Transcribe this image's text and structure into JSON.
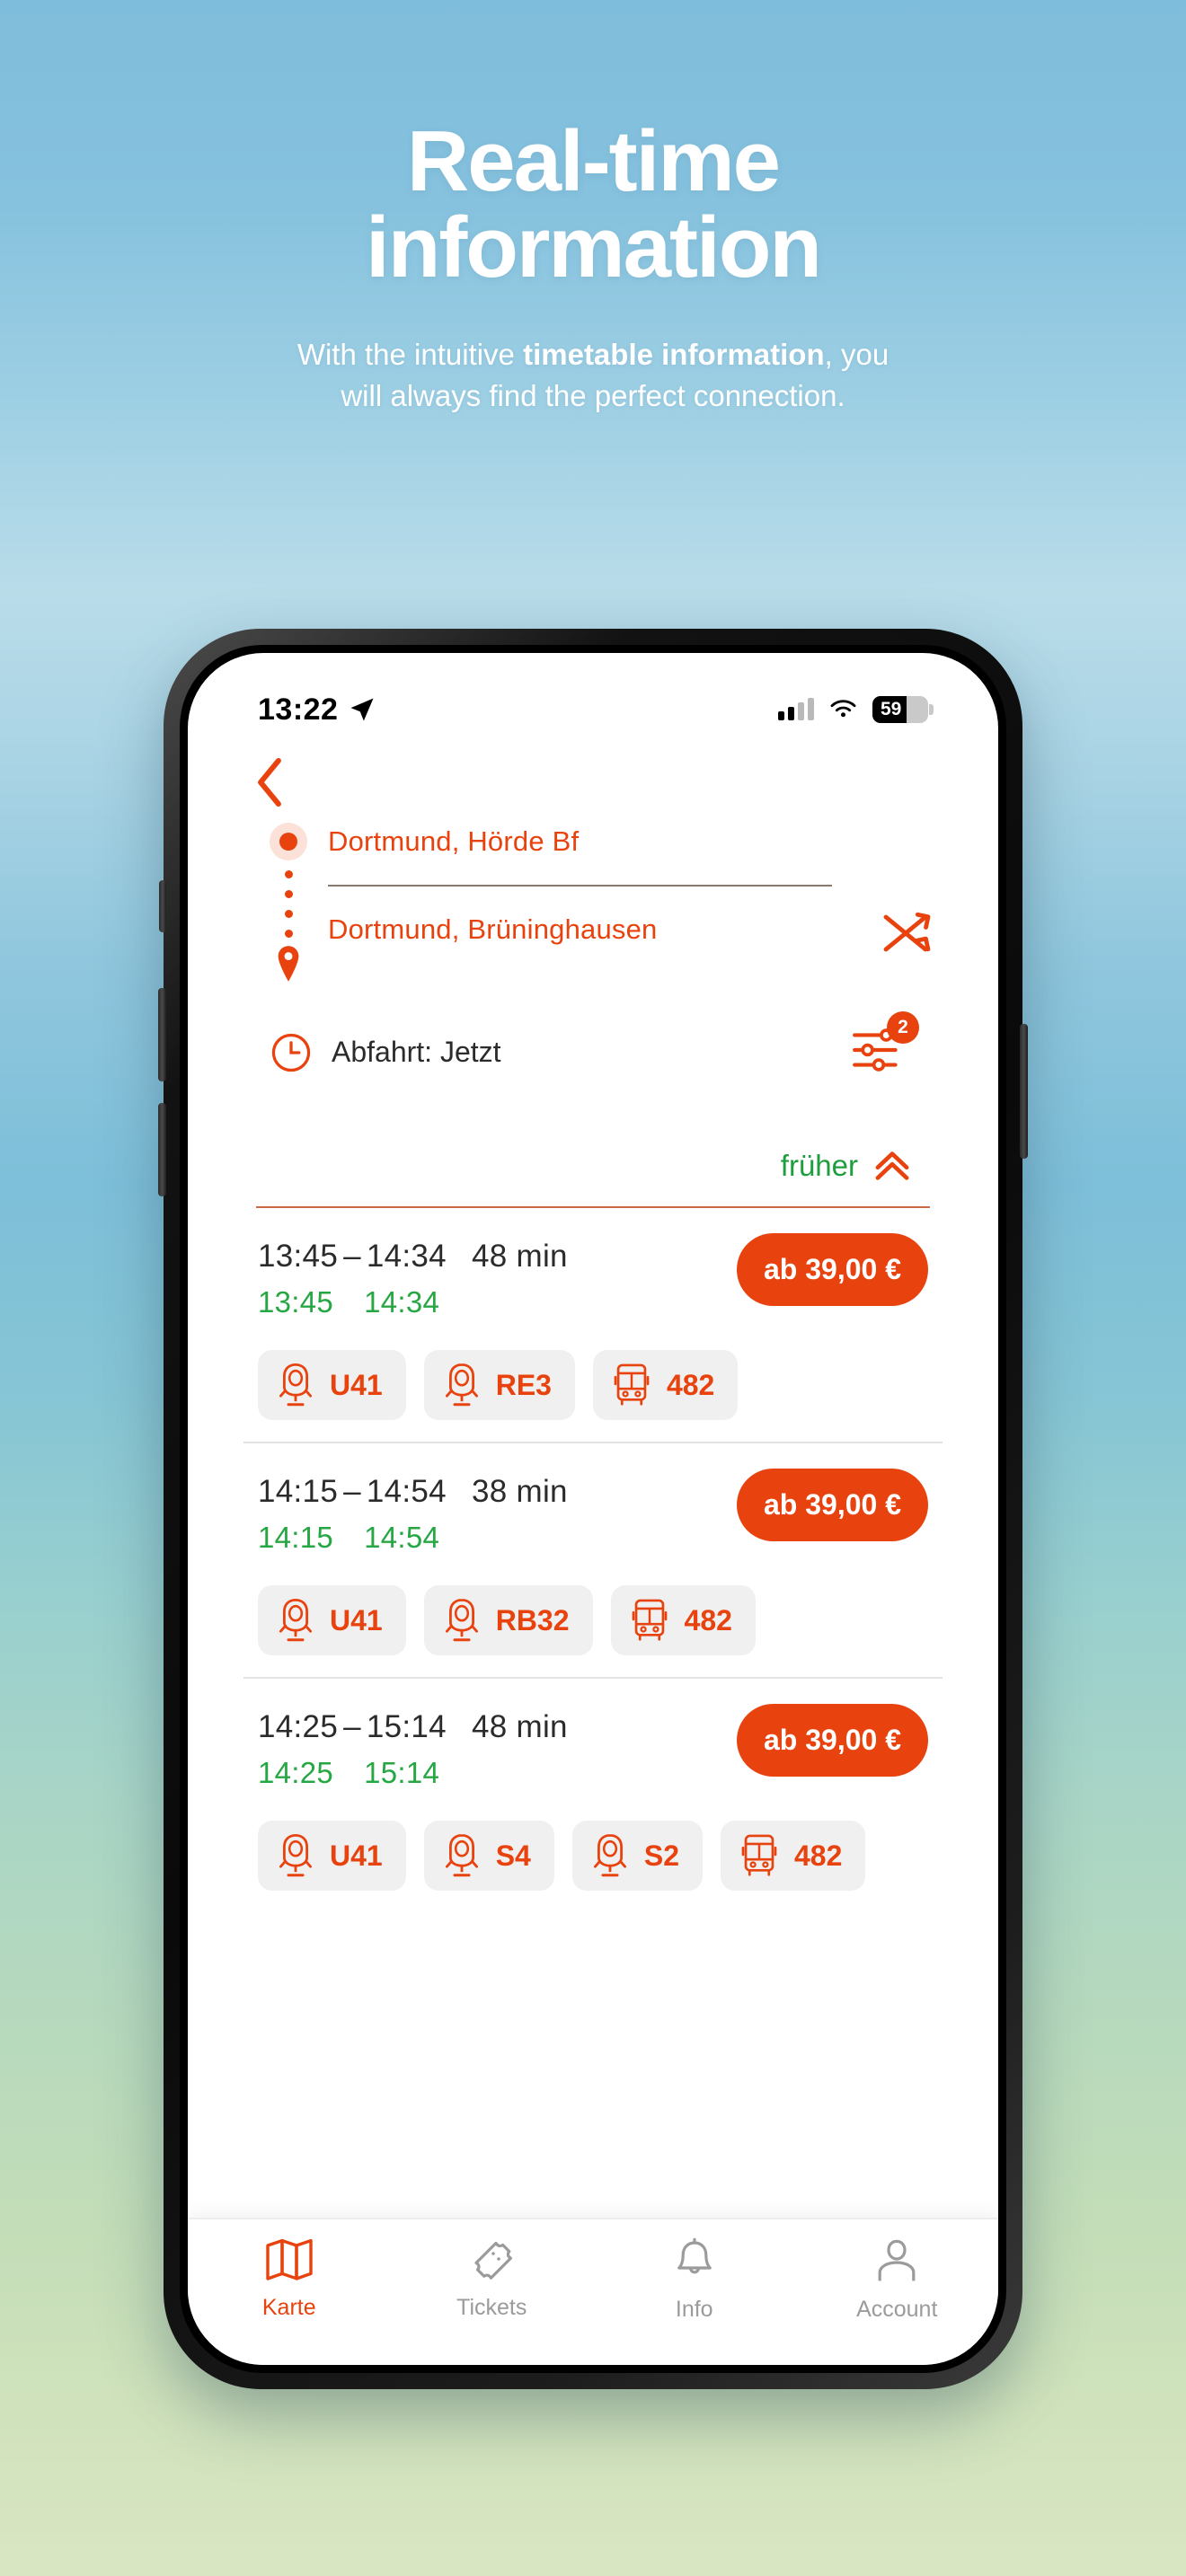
{
  "hero": {
    "title_line1": "Real-time",
    "title_line2": "information",
    "sub_pre": "With the intuitive ",
    "sub_bold": "timetable information",
    "sub_post": ", you",
    "sub_line2": "will always find the perfect connection."
  },
  "status_bar": {
    "time": "13:22",
    "location_icon": "location-arrow-icon",
    "signal_icon": "cellular-signal-icon",
    "wifi_icon": "wifi-icon",
    "battery_percent": "59",
    "battery_icon": "battery-icon"
  },
  "app": {
    "back_icon": "chevron-left-icon",
    "route": {
      "origin": "Dortmund, Hörde Bf",
      "destination": "Dortmund, Brüninghausen",
      "origin_icon": "circle-dot-icon",
      "destination_icon": "map-pin-icon",
      "swap_icon": "swap-arrows-icon"
    },
    "departure": {
      "clock_icon": "clock-icon",
      "label": "Abfahrt: Jetzt",
      "filter_icon": "filter-sliders-icon",
      "filter_badge": "2"
    },
    "earlier": {
      "label": "früher",
      "icon": "double-chevron-up-icon"
    },
    "connections": [
      {
        "planned_departure": "13:45",
        "dash": "–",
        "planned_arrival": "14:34",
        "duration": "48 min",
        "real_departure": "13:45",
        "real_arrival": "14:34",
        "price": "ab 39,00 €",
        "legs": [
          {
            "icon": "train-icon",
            "label": "U41"
          },
          {
            "icon": "train-icon",
            "label": "RE3"
          },
          {
            "icon": "bus-icon",
            "label": "482"
          }
        ]
      },
      {
        "planned_departure": "14:15",
        "dash": "–",
        "planned_arrival": "14:54",
        "duration": "38 min",
        "real_departure": "14:15",
        "real_arrival": "14:54",
        "price": "ab 39,00 €",
        "legs": [
          {
            "icon": "train-icon",
            "label": "U41"
          },
          {
            "icon": "train-icon",
            "label": "RB32"
          },
          {
            "icon": "bus-icon",
            "label": "482"
          }
        ]
      },
      {
        "planned_departure": "14:25",
        "dash": "–",
        "planned_arrival": "15:14",
        "duration": "48 min",
        "real_departure": "14:25",
        "real_arrival": "15:14",
        "price": "ab 39,00 €",
        "legs": [
          {
            "icon": "train-icon",
            "label": "U41"
          },
          {
            "icon": "train-icon",
            "label": "S4"
          },
          {
            "icon": "train-icon",
            "label": "S2"
          },
          {
            "icon": "bus-icon",
            "label": "482"
          }
        ]
      }
    ],
    "tabs": [
      {
        "label": "Karte",
        "icon": "map-icon",
        "active": true
      },
      {
        "label": "Tickets",
        "icon": "ticket-icon",
        "active": false
      },
      {
        "label": "Info",
        "icon": "bell-icon",
        "active": false
      },
      {
        "label": "Account",
        "icon": "person-icon",
        "active": false
      }
    ]
  },
  "colors": {
    "accent": "#E8430F",
    "realtime_green": "#27A744",
    "earlier_green": "#1E9E3E",
    "chip_bg": "#f0f0f0"
  }
}
